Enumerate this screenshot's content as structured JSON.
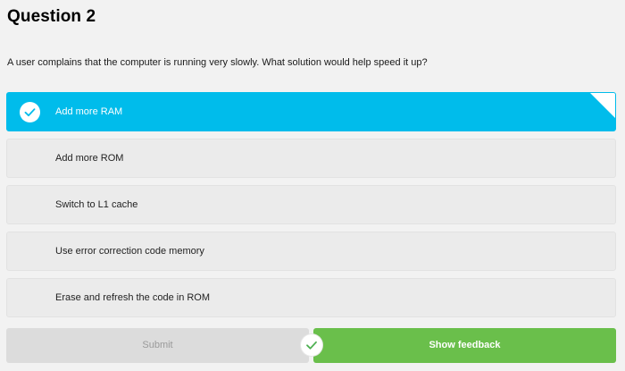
{
  "page": {
    "title": "Question 2",
    "question_text": "A user complains that the computer is running very slowly. What solution would help speed it up?"
  },
  "options": [
    {
      "label": "Add more RAM",
      "selected": true
    },
    {
      "label": "Add more ROM",
      "selected": false
    },
    {
      "label": "Switch to L1 cache",
      "selected": false
    },
    {
      "label": "Use error correction code memory",
      "selected": false
    },
    {
      "label": "Erase and refresh the code in ROM",
      "selected": false
    }
  ],
  "actions": {
    "submit_label": "Submit",
    "submit_enabled": false,
    "feedback_label": "Show feedback"
  },
  "icons": {
    "selected_option": "check-icon",
    "answer_status": "check-icon"
  },
  "colors": {
    "selected_option_bg": "#00bceb",
    "feedback_button_bg": "#6abf4b",
    "submit_button_bg": "#dcdcdc",
    "check_stroke_selected": "#00bceb",
    "check_stroke_status": "#4caf50"
  }
}
